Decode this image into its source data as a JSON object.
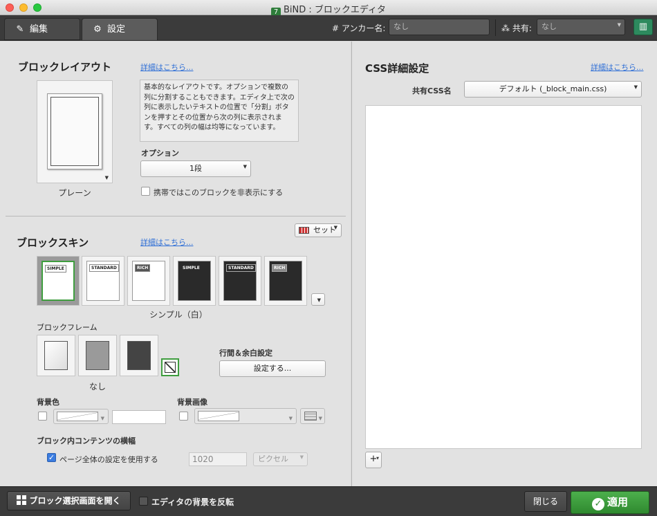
{
  "window": {
    "title": "BiND : ブロックエディタ",
    "app_icon": "7"
  },
  "toolbar": {
    "tabs": [
      {
        "label": "編集",
        "icon": "pencil-icon"
      },
      {
        "label": "設定",
        "icon": "gear-icon"
      }
    ],
    "anchor_label": "# アンカー名:",
    "anchor_placeholder": "なし",
    "share_label": "共有:",
    "share_value": "なし"
  },
  "layout": {
    "title": "ブロックレイアウト",
    "detail_link": "詳細はこちら...",
    "description": "基本的なレイアウトです。オプションで複数の列に分割することもできます。エディタ上で次の列に表示したいテキストの位置で「分割」ボタンを押すとその位置から次の列に表示されます。すべての列の幅は均等になっています。",
    "preview_name": "プレーン",
    "option_label": "オプション",
    "option_value": "1段",
    "mobile_hide_label": "携帯ではこのブロックを非表示にする",
    "mobile_hide_checked": false
  },
  "skin": {
    "title": "ブロックスキン",
    "detail_link": "詳細はこちら...",
    "set_label": "セット",
    "selected_name": "シンプル（白）",
    "thumbs": [
      {
        "name": "SIMPLE",
        "dark": false,
        "selected": true
      },
      {
        "name": "STANDARD",
        "dark": false,
        "selected": false
      },
      {
        "name": "RICH",
        "dark": false,
        "selected": false
      },
      {
        "name": "SIMPLE",
        "dark": true,
        "selected": false
      },
      {
        "name": "STANDARD",
        "dark": true,
        "selected": false
      },
      {
        "name": "RICH",
        "dark": true,
        "selected": false
      }
    ]
  },
  "frame": {
    "title": "ブロックフレーム",
    "selected_name": "なし"
  },
  "spacing": {
    "title": "行間＆余白設定",
    "button": "設定する..."
  },
  "bg_color": {
    "title": "背景色",
    "value": ""
  },
  "bg_image": {
    "title": "背景画像"
  },
  "content_width": {
    "title": "ブロック内コンテンツの横幅",
    "use_page_label": "ページ全体の設定を使用する",
    "use_page_checked": true,
    "value": "1020",
    "unit": "ピクセル"
  },
  "css": {
    "title": "CSS詳細設定",
    "detail_link": "詳細はこちら...",
    "shared_label": "共有CSS名",
    "shared_value": "デフォルト (_block_main.css)",
    "add_label": "+"
  },
  "bottom": {
    "open_selector": "ブロック選択画面を開く",
    "invert_bg": "エディタの背景を反転",
    "close": "閉じる",
    "apply": "適用"
  },
  "colors": {
    "accent_green": "#3f9d3f",
    "link": "#2f6fd6",
    "toolbar": "#3b3b3b"
  }
}
